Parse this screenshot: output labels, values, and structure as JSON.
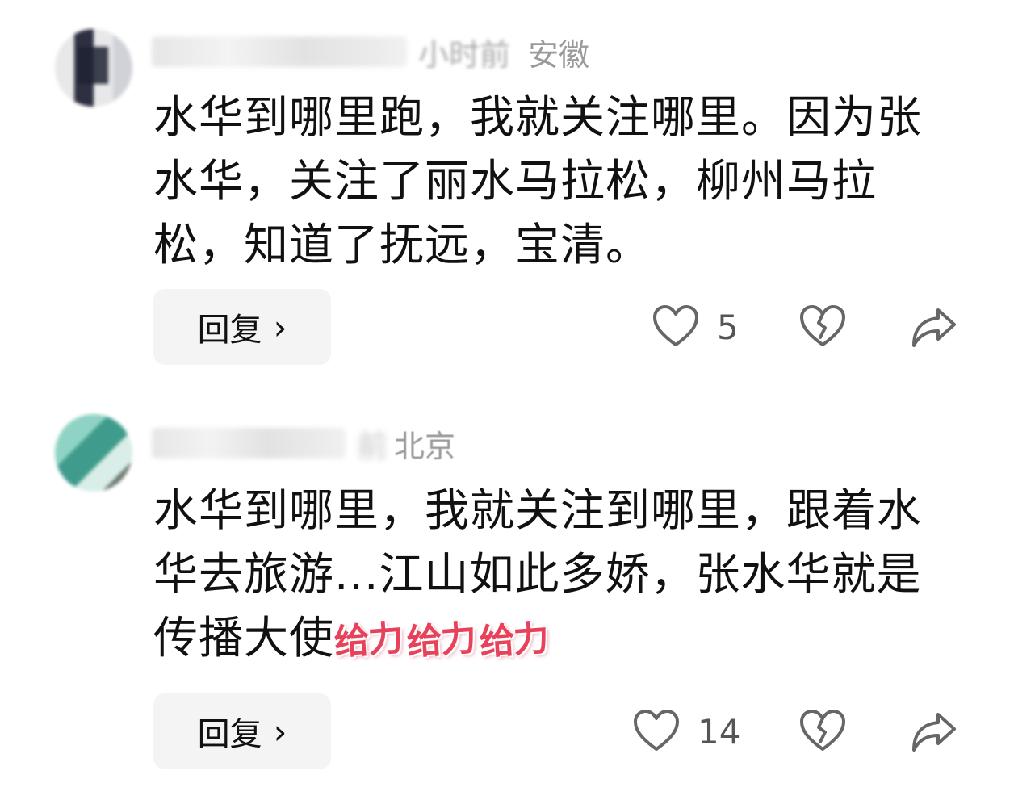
{
  "comments": [
    {
      "author": "",
      "time": "小时前",
      "location": "安徽",
      "text": "水华到哪里跑，我就关注哪里。因为张水华，关注了丽水马拉松，柳州马拉松，知道了抚远，宝清。",
      "sticker": "",
      "reply_label": "回复",
      "reply_chevron": "›",
      "likes": "5"
    },
    {
      "author": "",
      "time": "前",
      "location": "北京",
      "text": "水华到哪里，我就关注到哪里，跟着水华去旅游...江山如此多娇，张水华就是传播大使",
      "sticker": "给力",
      "reply_label": "回复",
      "reply_chevron": "›",
      "likes": "14"
    }
  ],
  "icons": {
    "like": "heart-outline-icon",
    "dislike": "broken-heart-outline-icon",
    "share": "share-arrow-icon"
  },
  "colors": {
    "text": "#111111",
    "meta": "#9a9a9a",
    "icon": "#666666",
    "sticker": "#e8425a",
    "button_bg": "#f4f4f4"
  }
}
